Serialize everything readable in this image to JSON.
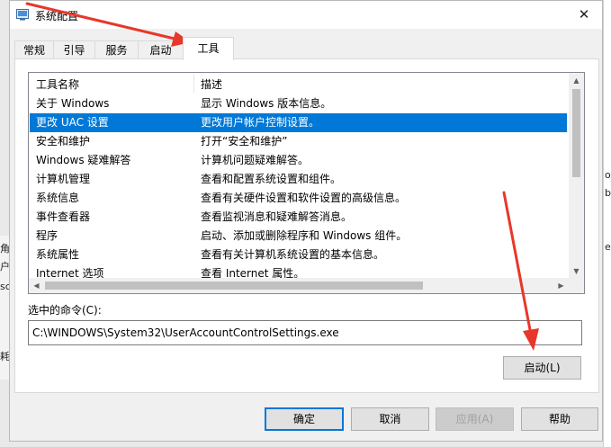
{
  "background": {
    "right_fragments": [
      "ox",
      "ba",
      "e"
    ],
    "left_fragments": [
      "角",
      "户",
      "sc",
      "耗"
    ]
  },
  "window": {
    "title": "系统配置",
    "close_glyph": "✕"
  },
  "tabs": [
    {
      "label": "常规"
    },
    {
      "label": "引导"
    },
    {
      "label": "服务"
    },
    {
      "label": "启动"
    },
    {
      "label": "工具"
    }
  ],
  "tools_table": {
    "headers": [
      "工具名称",
      "描述"
    ],
    "rows": [
      {
        "name": "关于 Windows",
        "desc": "显示 Windows 版本信息。"
      },
      {
        "name": "更改 UAC 设置",
        "desc": "更改用户帐户控制设置。"
      },
      {
        "name": "安全和维护",
        "desc": "打开“安全和维护”"
      },
      {
        "name": "Windows 疑难解答",
        "desc": "计算机问题疑难解答。"
      },
      {
        "name": "计算机管理",
        "desc": "查看和配置系统设置和组件。"
      },
      {
        "name": "系统信息",
        "desc": "查看有关硬件设置和软件设置的高级信息。"
      },
      {
        "name": "事件查看器",
        "desc": "查看监视消息和疑难解答消息。"
      },
      {
        "name": "程序",
        "desc": "启动、添加或删除程序和 Windows 组件。"
      },
      {
        "name": "系统属性",
        "desc": "查看有关计算机系统设置的基本信息。"
      },
      {
        "name": "Internet 选项",
        "desc": "查看 Internet 属性。"
      }
    ]
  },
  "command": {
    "label": "选中的命令(C):",
    "value": "C:\\WINDOWS\\System32\\UserAccountControlSettings.exe"
  },
  "buttons": {
    "launch": "启动(L)",
    "ok": "确定",
    "cancel": "取消",
    "apply": "应用(A)",
    "help": "帮助"
  },
  "colors": {
    "selection": "#0078d7",
    "annotation_arrow": "#e8372a"
  }
}
